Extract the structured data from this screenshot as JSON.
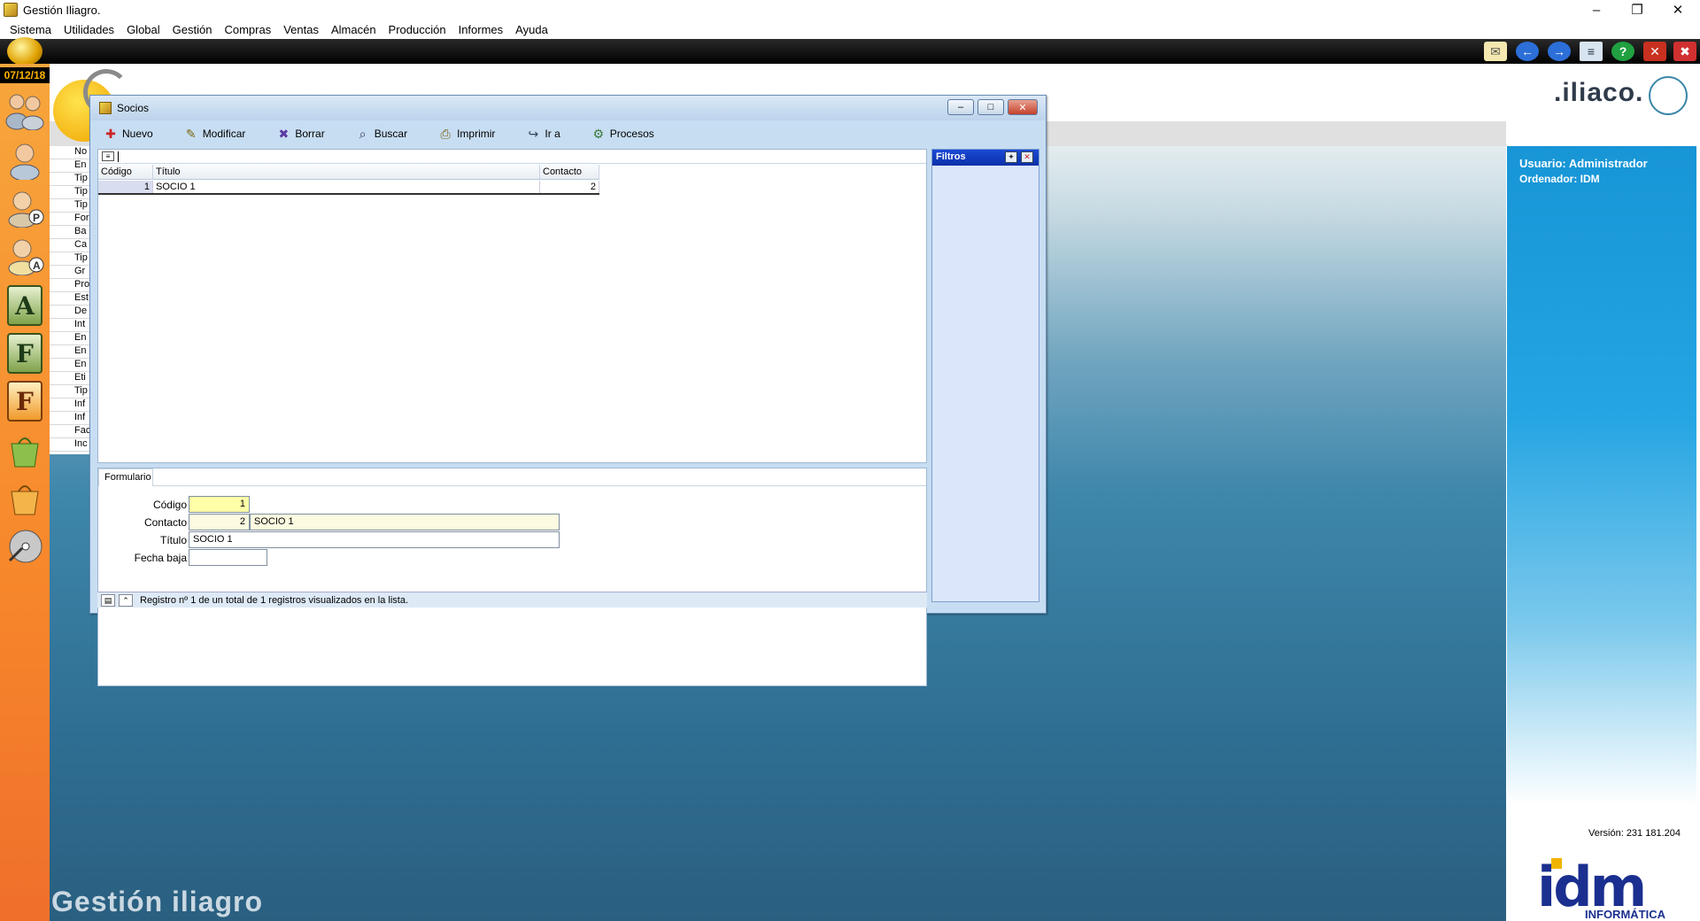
{
  "titlebar": {
    "title": "Gestión Iliagro."
  },
  "menu": [
    "Sistema",
    "Utilidades",
    "Global",
    "Gestión",
    "Compras",
    "Ventas",
    "Almacén",
    "Producción",
    "Informes",
    "Ayuda"
  ],
  "sidebar": {
    "date": "07/12/18"
  },
  "bglist": [
    "No",
    "En",
    "Tip",
    "Tip",
    "Tip",
    "For",
    "Ba",
    "Ca",
    "Tip",
    "Gr",
    "Pro",
    "Est",
    "De",
    "Int",
    "En",
    "En",
    "En",
    "Eti",
    "Tip",
    "Inf",
    "Inf",
    "Fac",
    "Inc"
  ],
  "brand": {
    "iliaco": ".iliaco.",
    "bottom_title": "Gestión iliagro"
  },
  "rightpanel": {
    "user": "Usuario: Administrador",
    "pc": "Ordenador: IDM",
    "version": "Versión: 231 181.204",
    "idm": "idm",
    "idm_sub": "INFORMÁTICA"
  },
  "window": {
    "title": "Socios",
    "toolbar": [
      "Nuevo",
      "Modificar",
      "Borrar",
      "Buscar",
      "Imprimir",
      "Ir a",
      "Procesos"
    ],
    "grid": {
      "headers": [
        "Código",
        "Título",
        "Contacto"
      ],
      "rows": [
        {
          "codigo": "1",
          "titulo": "SOCIO 1",
          "contacto": "2"
        }
      ]
    },
    "form": {
      "tab": "Formulario",
      "codigo_label": "Código",
      "codigo_value": "1",
      "contacto_label": "Contacto",
      "contacto_value": "2",
      "contacto_name": "SOCIO 1",
      "titulo_label": "Título",
      "titulo_value": "SOCIO 1",
      "fechabaja_label": "Fecha baja",
      "fechabaja_value": ""
    },
    "filters": {
      "title": "Filtros"
    },
    "status": "Registro nº 1 de un total de 1 registros visualizados en la lista."
  }
}
